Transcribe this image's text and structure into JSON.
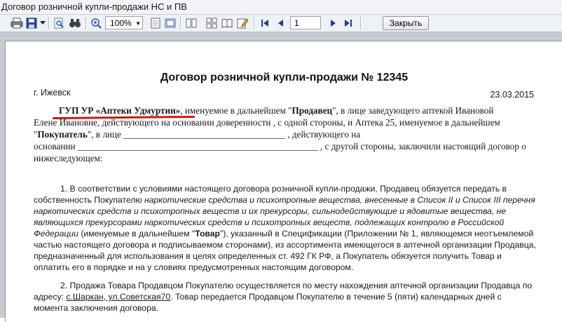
{
  "window": {
    "title": "Договор розничной купли-продажи НС и ПВ"
  },
  "toolbar": {
    "icons": [
      "print-icon",
      "save-icon",
      "dropdown-arrow-icon",
      "find-icon",
      "binoculars-icon",
      "zoom-in-icon",
      "one-page-icon",
      "two-pages-icon",
      "multi-page-icon",
      "book-icon",
      "edit-icon",
      "first-page-icon",
      "prev-page-icon",
      "next-page-icon",
      "last-page-icon"
    ],
    "zoom_value": "100%",
    "page_number": "1",
    "close_label": "Закрыть"
  },
  "document": {
    "title": "Договор розничной купли-продажи № 12345",
    "city": "г. Ижевск",
    "date": "23.03.2015",
    "intro": {
      "line1": {
        "seller_name": "ГУП УР «Аптеки Удмуртии»",
        "t1": ", именуемое в дальнейшем \"",
        "seller_role": "Продавец",
        "t2": "\", в лице заведующего аптекой Ивановой"
      },
      "line2": "Елене Ивановне, действующего на основании доверенности , с одной стороны, и Аптека 25, именуемое в дальнейшем",
      "line3": {
        "q": "\"",
        "buyer_role": "Покупатель",
        "rest": "\", в лице ___________________________________ , действующего на"
      },
      "line4": "основании ____________________________________________________ , с другой стороны, заключили настоящий договор о",
      "line5": "нижеследующем:"
    },
    "clause1": {
      "l1": "1. В соответствии с условиями настоящего договора розничной купли-продажи, Продавец обязуется передать в",
      "l2_a": "собственность Покупателю ",
      "l2_b": "наркотические средства и психотропные вещества, внесенные в Список II и Список III перечня",
      "l3": "наркотических средств и психотропных веществ и их прекурсоры, сильнодействующие и ядовитые вещества, не",
      "l4": "являющихся прекурсорами наркотических средств и психотропных веществ, подлежащих контролю в Российской",
      "l5_a": "Федерации",
      "l5_b": " (именуемые в дальнейшем \"",
      "l5_c": "Товар",
      "l5_d": "\"), указанный в Спецификации (Приложении № 1, являющемся неотъемлемой",
      "l6": "частью настоящего договора и подписываемом сторонами), из ассортимента имеющегося в аптечной организации Продавца,",
      "l7": "предназначенный для использования в целях определенных ст. 492 ГК РФ, а Покупатель обязуется получить Товар и",
      "l8": "оплатить его в порядке и на у словиях предусмотренных настоящим договором."
    },
    "clause2": {
      "l1": "2. Продажа Товара Продавцом Покупателю осуществляется по месту нахождения аптечной организации Продавца по",
      "l2_a": "адресу: ",
      "l2_addr": "с.Шаркан, ул.Советская70",
      "l2_b": ". Товар передается Продавцом Покупателю в течение 5 (пяти) календарных дней с",
      "l3": "момента заключения договора."
    }
  }
}
